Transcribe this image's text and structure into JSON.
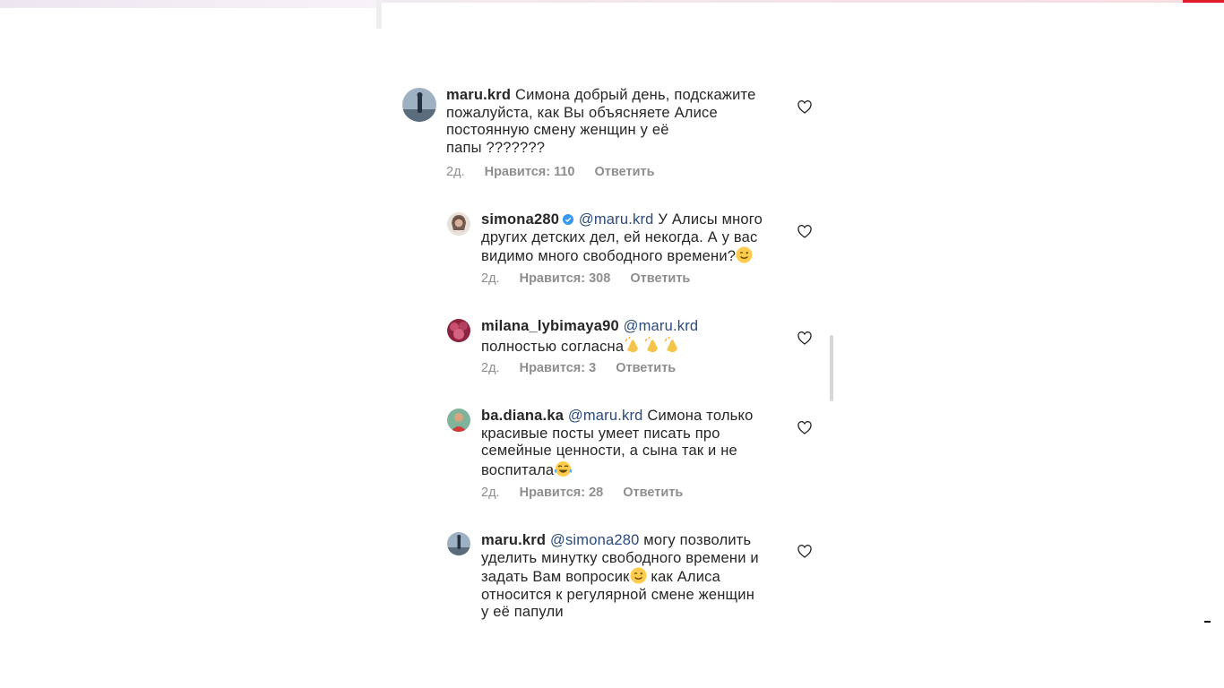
{
  "colors": {
    "text": "#262626",
    "meta": "#8e8e8e",
    "mention": "#2b4a7d",
    "verified": "#3897f0",
    "accent_red": "#e21b2b"
  },
  "comments": [
    {
      "username": "maru.krd",
      "lines": [
        "Симона добрый день, подскажите",
        "пожалуйста,  как Вы объясняете Алисе",
        "постоянную смену женщин у её",
        "папы ???????"
      ],
      "time": "2д.",
      "likes": "Нравится: 110",
      "reply": "Ответить"
    },
    {
      "username": "simona280",
      "verified": true,
      "mention": "@maru.krd",
      "lines": [
        "У Алисы много",
        "других детских дел, ей некогда. А у вас",
        "видимо много свободного времени?"
      ],
      "emoji": "winking-face",
      "time": "2д.",
      "likes": "Нравится: 308",
      "reply": "Ответить"
    },
    {
      "username": "milana_lybimaya90",
      "mention": "@maru.krd",
      "lines": [
        "полностью согласна"
      ],
      "emoji": "clapping-hands x3",
      "time": "2д.",
      "likes": "Нравится: 3",
      "reply": "Ответить"
    },
    {
      "username": "ba.diana.ka",
      "mention": "@maru.krd",
      "lines": [
        "Симона только",
        "красивые посты умеет писать про",
        "семейные ценности, а сына так и не",
        "воспитала"
      ],
      "emoji": "tears-of-joy",
      "time": "2д.",
      "likes": "Нравится: 28",
      "reply": "Ответить"
    },
    {
      "username": "maru.krd",
      "mention": "@simona280",
      "lines": [
        "могу позволить",
        "уделить минутку свободного времени и",
        "задать Вам вопросик",
        " как Алиса",
        "относится к регулярной смене женщин",
        "у её папули"
      ],
      "emoji": "winking-face"
    }
  ],
  "icons": {
    "heart": "heart-outline-icon",
    "verified": "verified-badge-icon"
  }
}
